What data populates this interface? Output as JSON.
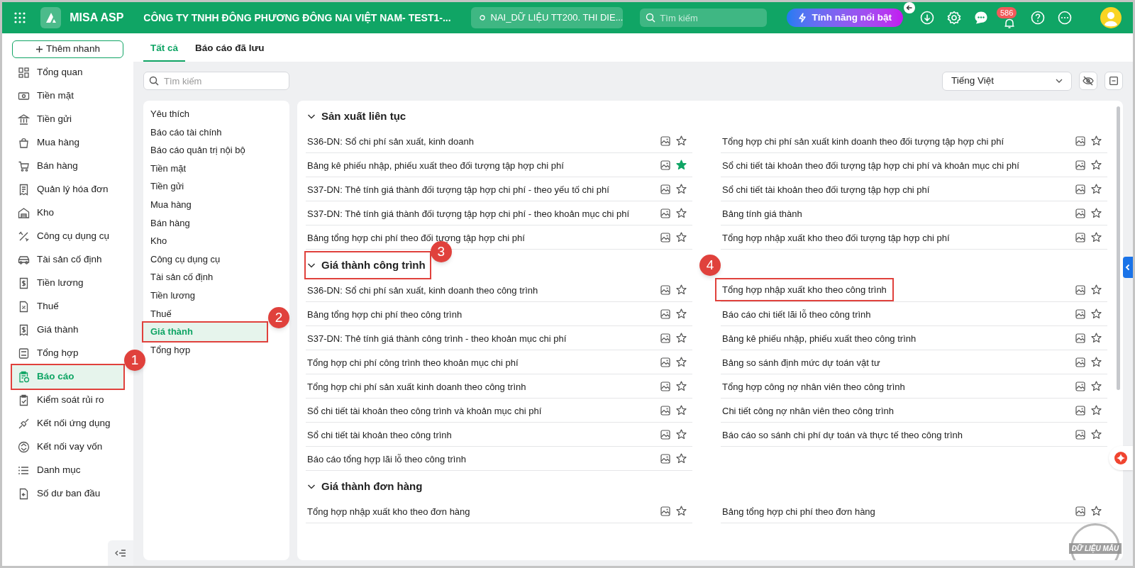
{
  "topbar": {
    "app_name": "MISA ASP",
    "company": "CÔNG TY TNHH ĐÔNG PHƯƠNG ĐÔNG NAI VIỆT NAM- TEST1-...",
    "database": "NAI_DỮ LIỆU TT200. THI DIE...",
    "search_placeholder": "Tìm kiếm",
    "feature_button": "Tính năng nổi bật",
    "notification_count": "586"
  },
  "sidebar": {
    "quick_add": "Thêm nhanh",
    "items": [
      {
        "label": "Tổng quan",
        "selected": false
      },
      {
        "label": "Tiền mặt",
        "selected": false
      },
      {
        "label": "Tiền gửi",
        "selected": false
      },
      {
        "label": "Mua hàng",
        "selected": false
      },
      {
        "label": "Bán hàng",
        "selected": false
      },
      {
        "label": "Quản lý hóa đơn",
        "selected": false
      },
      {
        "label": "Kho",
        "selected": false
      },
      {
        "label": "Công cụ dụng cụ",
        "selected": false
      },
      {
        "label": "Tài sản cố định",
        "selected": false
      },
      {
        "label": "Tiền lương",
        "selected": false
      },
      {
        "label": "Thuế",
        "selected": false
      },
      {
        "label": "Giá thành",
        "selected": false
      },
      {
        "label": "Tổng hợp",
        "selected": false
      },
      {
        "label": "Báo cáo",
        "selected": true,
        "callout": "1"
      },
      {
        "label": "Kiểm soát rủi ro",
        "selected": false
      },
      {
        "label": "Kết nối ứng dụng",
        "selected": false
      },
      {
        "label": "Kết nối vay vốn",
        "selected": false
      },
      {
        "label": "Danh mục",
        "selected": false
      },
      {
        "label": "Số dư ban đầu",
        "selected": false
      }
    ]
  },
  "tabs": [
    {
      "label": "Tất cả",
      "selected": true
    },
    {
      "label": "Báo cáo đã lưu",
      "selected": false
    }
  ],
  "report_search": {
    "placeholder": "Tìm kiếm"
  },
  "language": "Tiếng Việt",
  "categories": [
    {
      "label": "Yêu thích",
      "selected": false
    },
    {
      "label": "Báo cáo tài chính",
      "selected": false
    },
    {
      "label": "Báo cáo quản trị nội bộ",
      "selected": false
    },
    {
      "label": "Tiền mặt",
      "selected": false
    },
    {
      "label": "Tiền gửi",
      "selected": false
    },
    {
      "label": "Mua hàng",
      "selected": false
    },
    {
      "label": "Bán hàng",
      "selected": false
    },
    {
      "label": "Kho",
      "selected": false
    },
    {
      "label": "Công cụ dụng cụ",
      "selected": false
    },
    {
      "label": "Tài sản cố định",
      "selected": false
    },
    {
      "label": "Tiền lương",
      "selected": false
    },
    {
      "label": "Thuế",
      "selected": false
    },
    {
      "label": "Giá thành",
      "selected": true,
      "callout": "2"
    },
    {
      "label": "Tổng hợp",
      "selected": false
    }
  ],
  "sections": [
    {
      "title": "Sản xuất liên tục",
      "expanded": true,
      "items": [
        {
          "label": "S36-DN: Sổ chi phí sản xuất, kinh doanh",
          "favorite": false
        },
        {
          "label": "Tổng hợp chi phí sản xuất kinh doanh theo đối tượng tập hợp chi phí",
          "favorite": false
        },
        {
          "label": "Bảng kê phiếu nhập, phiếu xuất theo đối tượng tập hợp chi phí",
          "favorite": true
        },
        {
          "label": "Sổ chi tiết tài khoản theo đối tượng tập hợp chi phí và khoản mục chi phí",
          "favorite": false
        },
        {
          "label": "S37-DN: Thẻ tính giá thành đối tượng tập hợp chi phí - theo yếu tố chi phí",
          "favorite": false
        },
        {
          "label": "Sổ chi tiết tài khoản theo đối tượng tập hợp chi phí",
          "favorite": false
        },
        {
          "label": "S37-DN: Thẻ tính giá thành đối tượng tập hợp chi phí - theo khoản mục chi phí",
          "favorite": false
        },
        {
          "label": "Bảng tính giá thành",
          "favorite": false
        },
        {
          "label": "Bảng tổng hợp chi phí theo đối tượng tập hợp chi phí",
          "favorite": false
        },
        {
          "label": "Tổng hợp nhập xuất kho theo đối tượng tập hợp chi phí",
          "favorite": false
        }
      ]
    },
    {
      "title": "Giá thành công trình",
      "expanded": true,
      "callout": "3",
      "items": [
        {
          "label": "S36-DN: Sổ chi phí sản xuất, kinh doanh theo công trình",
          "favorite": false
        },
        {
          "label": "Tổng hợp nhập xuất kho theo công trình",
          "favorite": false,
          "callout": "4"
        },
        {
          "label": "Bảng tổng hợp chi phí theo công trình",
          "favorite": false
        },
        {
          "label": "Báo cáo chi tiết lãi lỗ theo công trình",
          "favorite": false
        },
        {
          "label": "S37-DN: Thẻ tính giá thành công trình - theo khoản mục chi phí",
          "favorite": false
        },
        {
          "label": "Bảng kê phiếu nhập, phiếu xuất theo công trình",
          "favorite": false
        },
        {
          "label": "Tổng hợp chi phí công trình theo khoản mục chi phí",
          "favorite": false
        },
        {
          "label": "Bảng so sánh định mức dự toán vật tư",
          "favorite": false
        },
        {
          "label": "Tổng hợp chi phí sản xuất kinh doanh theo công trình",
          "favorite": false
        },
        {
          "label": "Tổng hợp công nợ nhân viên theo công trình",
          "favorite": false
        },
        {
          "label": "Sổ chi tiết tài khoản theo công trình và khoản mục chi phí",
          "favorite": false
        },
        {
          "label": "Chi tiết công nợ nhân viên theo công trình",
          "favorite": false
        },
        {
          "label": "Sổ chi tiết tài khoản theo công trình",
          "favorite": false
        },
        {
          "label": "Báo cáo so sánh chi phí dự toán và thực tế theo công trình",
          "favorite": false
        },
        {
          "label": "Báo cáo tổng hợp lãi lỗ theo công trình",
          "favorite": false
        }
      ]
    },
    {
      "title": "Giá thành đơn hàng",
      "expanded": true,
      "items": [
        {
          "label": "Tổng hợp nhập xuất kho theo đơn hàng",
          "favorite": false
        },
        {
          "label": "Bảng tổng hợp chi phí theo đơn hàng",
          "favorite": false
        }
      ]
    }
  ],
  "sample_stamp": "DỮ LIỆU MẪU"
}
